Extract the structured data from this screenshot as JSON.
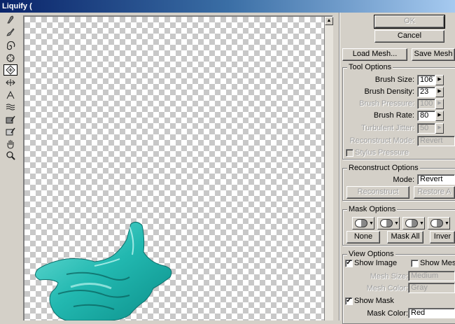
{
  "window": {
    "title": "Liquify ("
  },
  "tools": [
    {
      "name": "forward-warp-tool-icon",
      "glyph": "✎",
      "active": false
    },
    {
      "name": "reconstruct-tool-icon",
      "glyph": "✐",
      "active": false
    },
    {
      "name": "twirl-clockwise-tool-icon",
      "glyph": "@",
      "active": false
    },
    {
      "name": "pucker-tool-icon",
      "glyph": "✺",
      "active": false
    },
    {
      "name": "bloat-tool-icon",
      "glyph": "◇",
      "active": true
    },
    {
      "name": "push-left-tool-icon",
      "glyph": "⇹",
      "active": false
    },
    {
      "name": "mirror-tool-icon",
      "glyph": "⍝",
      "active": false
    },
    {
      "name": "turbulence-tool-icon",
      "glyph": "≋",
      "active": false
    },
    {
      "name": "freeze-mask-tool-icon",
      "glyph": "✍",
      "active": false
    },
    {
      "name": "thaw-mask-tool-icon",
      "glyph": "✑",
      "active": false
    },
    {
      "name": "hand-tool-icon",
      "glyph": "✋",
      "active": false
    },
    {
      "name": "zoom-tool-icon",
      "glyph": "⚲",
      "active": false
    }
  ],
  "buttons": {
    "ok": "OK",
    "cancel": "Cancel",
    "load_mesh": "Load Mesh...",
    "save_mesh": "Save Mesh"
  },
  "tool_options": {
    "title": "Tool Options",
    "brush_size_label": "Brush Size:",
    "brush_size": "106",
    "brush_density_label": "Brush Density:",
    "brush_density": "23",
    "brush_pressure_label": "Brush Pressure:",
    "brush_pressure": "100",
    "brush_rate_label": "Brush Rate:",
    "brush_rate": "80",
    "turbulent_jitter_label": "Turbulent Jitter:",
    "turbulent_jitter": "50",
    "reconstruct_mode_label": "Reconstruct Mode:",
    "reconstruct_mode": "Revert",
    "stylus_pressure_label": "Stylus Pressure"
  },
  "reconstruct_options": {
    "title": "Reconstruct Options",
    "mode_label": "Mode:",
    "mode": "Revert",
    "reconstruct_button": "Reconstruct",
    "restore_all_button": "Restore A"
  },
  "mask_options": {
    "title": "Mask Options",
    "none_button": "None",
    "mask_all_button": "Mask All",
    "invert_button": "Inver"
  },
  "view_options": {
    "title": "View Options",
    "show_image_label": "Show Image",
    "show_image": true,
    "show_mesh_label": "Show Mesh",
    "show_mesh": false,
    "mesh_size_label": "Mesh Size:",
    "mesh_size": "Medium",
    "mesh_color_label": "Mesh Color:",
    "mesh_color": "Gray",
    "show_mask_label": "Show Mask",
    "show_mask": true,
    "mask_color_label": "Mask Color:",
    "mask_color": "Red"
  },
  "colors": {
    "paint": "#22b8b0",
    "paint_dark": "#0c6e6a",
    "paint_light": "#6fe0d8",
    "dialog": "#d4d0c8"
  }
}
